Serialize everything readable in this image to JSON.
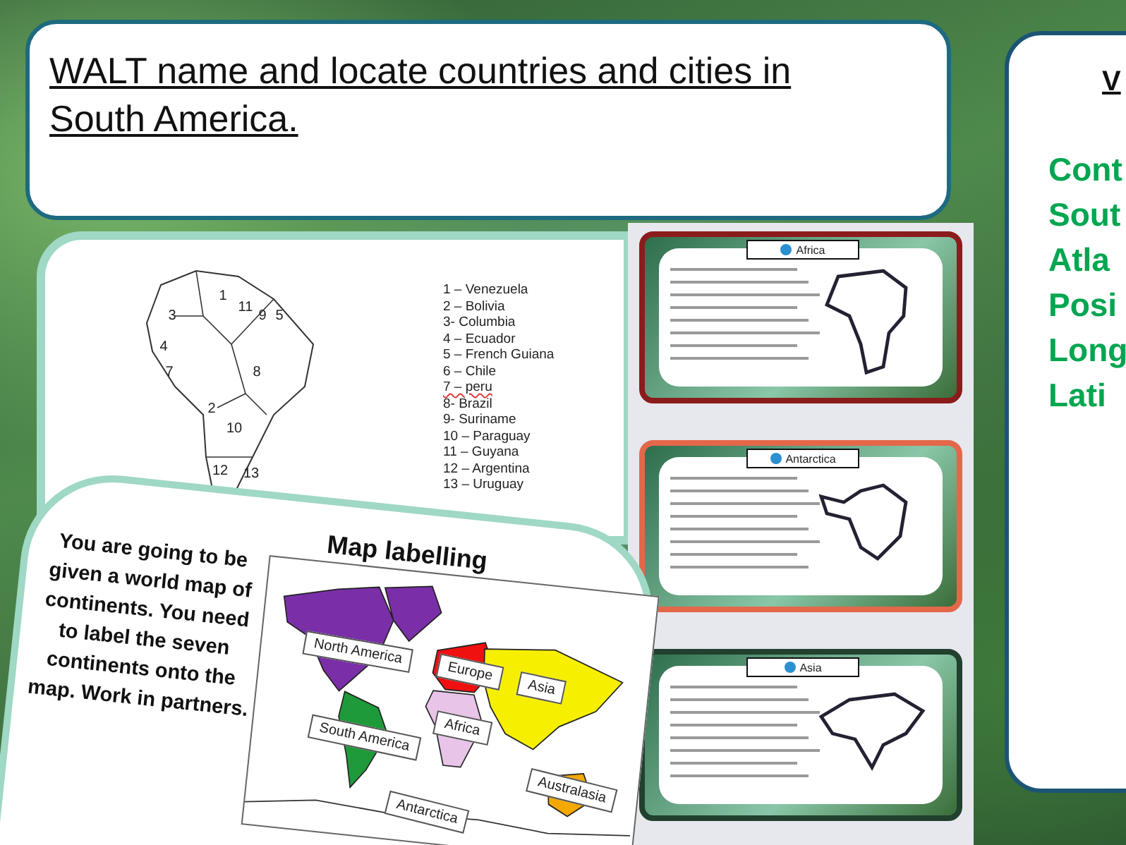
{
  "walt": {
    "text": "WALT name and locate countries and cities in South America."
  },
  "country_slide": {
    "map_numbers": [
      "1",
      "3",
      "11",
      "9",
      "5",
      "4",
      "7",
      "8",
      "2",
      "10",
      "12",
      "13"
    ],
    "key": [
      {
        "text": "1 – Venezuela",
        "flagged": false
      },
      {
        "text": "2 – Bolivia",
        "flagged": false
      },
      {
        "text": "3- Columbia",
        "flagged": false
      },
      {
        "text": "4 – Ecuador",
        "flagged": false
      },
      {
        "text": "5 – French Guiana",
        "flagged": false
      },
      {
        "text": "6 – Chile",
        "flagged": false
      },
      {
        "text": "7 – peru",
        "flagged": true
      },
      {
        "text": "8- Brazil",
        "flagged": false
      },
      {
        "text": "9- Suriname",
        "flagged": false
      },
      {
        "text": "10 – Paraguay",
        "flagged": false
      },
      {
        "text": "11 – Guyana",
        "flagged": false
      },
      {
        "text": "12 – Argentina",
        "flagged": false
      },
      {
        "text": "13 – Uruguay",
        "flagged": false
      }
    ]
  },
  "thumbnails": [
    {
      "title": "Africa",
      "color": "#8b1c1c"
    },
    {
      "title": "Antarctica",
      "color": "#e4674a"
    },
    {
      "title": "Asia",
      "color": "#22402e"
    }
  ],
  "map_labelling_slide": {
    "instructions": "You are going to be given a world map of continents. You need to label the seven continents onto the map. Work in partners.",
    "title": "Map labelling",
    "labels": [
      "North America",
      "Europe",
      "Asia",
      "Africa",
      "South America",
      "Australasia",
      "Antarctica"
    ]
  },
  "vocab_card": {
    "heading": "V",
    "words": [
      "Cont",
      "Sout",
      "Atla",
      "Posi",
      "Long",
      "Lati"
    ]
  }
}
